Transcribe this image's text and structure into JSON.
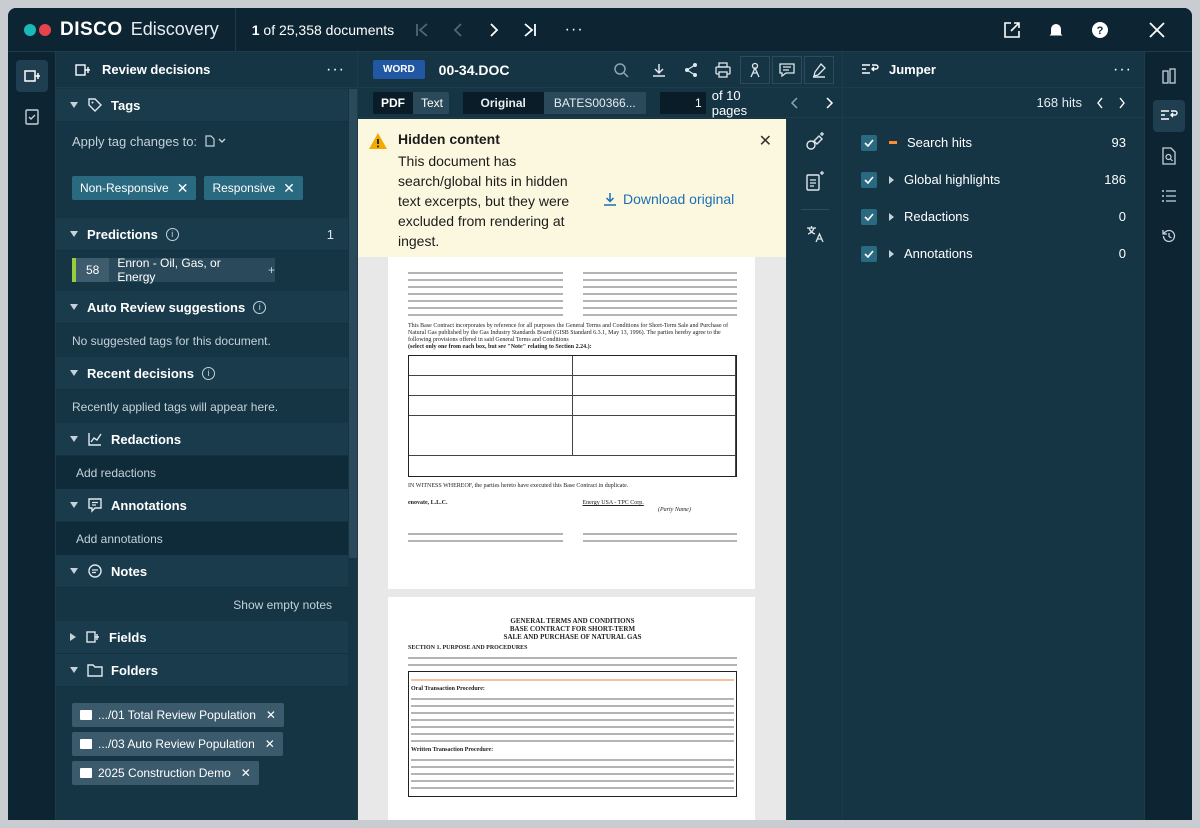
{
  "app": {
    "brand": "DISCO",
    "brand_sub": "Ediscovery",
    "doc_current": "1",
    "doc_total_text": "of 25,358 documents",
    "dot_colors": [
      "#19b9b9",
      "#e8424a"
    ]
  },
  "review": {
    "title": "Review decisions",
    "tags": {
      "title": "Tags",
      "apply_label": "Apply tag changes to:",
      "items": [
        "Non-Responsive",
        "Responsive"
      ]
    },
    "predictions": {
      "title": "Predictions",
      "count": "1",
      "score": "58",
      "name": "Enron - Oil, Gas, or Energy"
    },
    "auto": {
      "title": "Auto Review suggestions",
      "empty": "No suggested tags for this document."
    },
    "recent": {
      "title": "Recent decisions",
      "empty": "Recently applied tags will appear here."
    },
    "redactions": {
      "title": "Redactions",
      "add": "Add redactions"
    },
    "annotations": {
      "title": "Annotations",
      "add": "Add annotations"
    },
    "notes": {
      "title": "Notes",
      "show_empty": "Show empty notes"
    },
    "fields": {
      "title": "Fields"
    },
    "folders": {
      "title": "Folders",
      "items": [
        ".../01 Total Review Population",
        ".../03 Auto Review Population",
        "2025 Construction Demo"
      ]
    }
  },
  "doc": {
    "type_badge": "WORD",
    "name": "00-34.DOC",
    "view_pdf": "PDF",
    "view_text": "Text",
    "original": "Original",
    "bates": "BATES00366...",
    "page_value": "1",
    "page_total": "of 10 pages",
    "banner": {
      "title": "Hidden content",
      "text": "This document has search/global hits in hidden text excerpts, but they were excluded from rendering at ingest.",
      "download": "Download original"
    },
    "page2": {
      "heading1": "GENERAL TERMS AND CONDITIONS",
      "heading2": "BASE CONTRACT FOR SHORT-TERM",
      "heading3": "SALE AND PURCHASE OF NATURAL GAS",
      "section": "SECTION 1.  PURPOSE AND PROCEDURES",
      "oral": "Oral Transaction Procedure:",
      "written": "Written Transaction Procedure:"
    },
    "page1": {
      "incorporates": "This Base Contract incorporates by reference for all purposes the General Terms and Conditions for Short-Term Sale and Purchase of Natural Gas published by the Gas Industry Standards Board (GISB Standard 6.3.1, May 13, 1996). The parties hereby agree to the following provisions offered in said General Terms and Conditions",
      "select": "(select only one from each box, but see \"Note\" relating to Section 2.24.):",
      "witness": "IN WITNESS WHEREOF, the parties hereto have executed this Base Contract in duplicate.",
      "party1": "enovate, L.L.C.",
      "party2": "Energy USA - TPC Corp.",
      "party_name": "(Party Name)"
    }
  },
  "jumper": {
    "title": "Jumper",
    "hits": "168 hits",
    "rows": [
      {
        "label": "Search hits",
        "count": "93"
      },
      {
        "label": "Global highlights",
        "count": "186"
      },
      {
        "label": "Redactions",
        "count": "0"
      },
      {
        "label": "Annotations",
        "count": "0"
      }
    ]
  }
}
